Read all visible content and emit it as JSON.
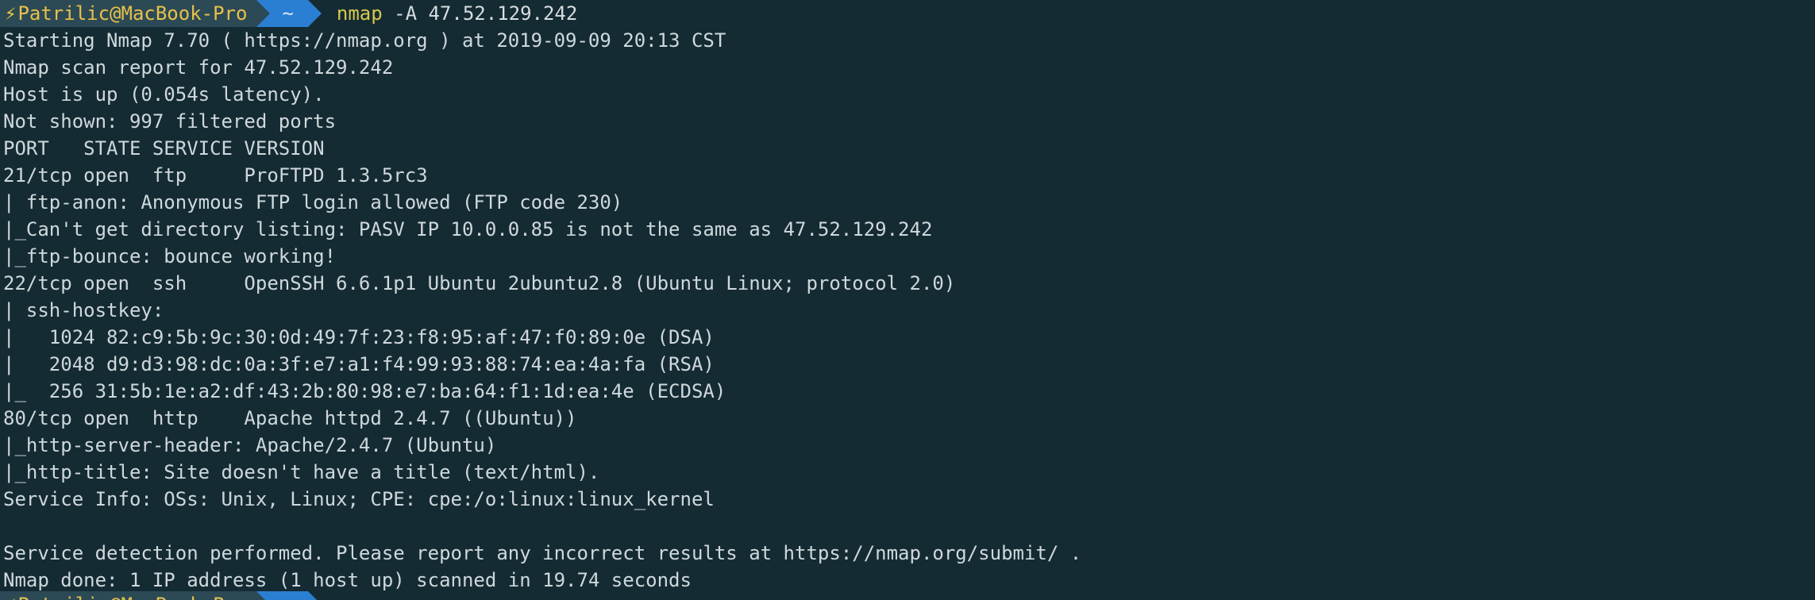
{
  "prompt": {
    "lightning": "⚡",
    "user_host": "Patrilic@MacBook-Pro",
    "directory": "~",
    "command": "nmap",
    "arguments": " -A 47.52.129.242"
  },
  "output": [
    "Starting Nmap 7.70 ( https://nmap.org ) at 2019-09-09 20:13 CST",
    "Nmap scan report for 47.52.129.242",
    "Host is up (0.054s latency).",
    "Not shown: 997 filtered ports",
    "PORT   STATE SERVICE VERSION",
    "21/tcp open  ftp     ProFTPD 1.3.5rc3",
    "| ftp-anon: Anonymous FTP login allowed (FTP code 230)",
    "|_Can't get directory listing: PASV IP 10.0.0.85 is not the same as 47.52.129.242",
    "|_ftp-bounce: bounce working!",
    "22/tcp open  ssh     OpenSSH 6.6.1p1 Ubuntu 2ubuntu2.8 (Ubuntu Linux; protocol 2.0)",
    "| ssh-hostkey: ",
    "|   1024 82:c9:5b:9c:30:0d:49:7f:23:f8:95:af:47:f0:89:0e (DSA)",
    "|   2048 d9:d3:98:dc:0a:3f:e7:a1:f4:99:93:88:74:ea:4a:fa (RSA)",
    "|_  256 31:5b:1e:a2:df:43:2b:80:98:e7:ba:64:f1:1d:ea:4e (ECDSA)",
    "80/tcp open  http    Apache httpd 2.4.7 ((Ubuntu))",
    "|_http-server-header: Apache/2.4.7 (Ubuntu)",
    "|_http-title: Site doesn't have a title (text/html).",
    "Service Info: OSs: Unix, Linux; CPE: cpe:/o:linux:linux_kernel",
    "",
    "Service detection performed. Please report any incorrect results at https://nmap.org/submit/ .",
    "Nmap done: 1 IP address (1 host up) scanned in 19.74 seconds"
  ]
}
